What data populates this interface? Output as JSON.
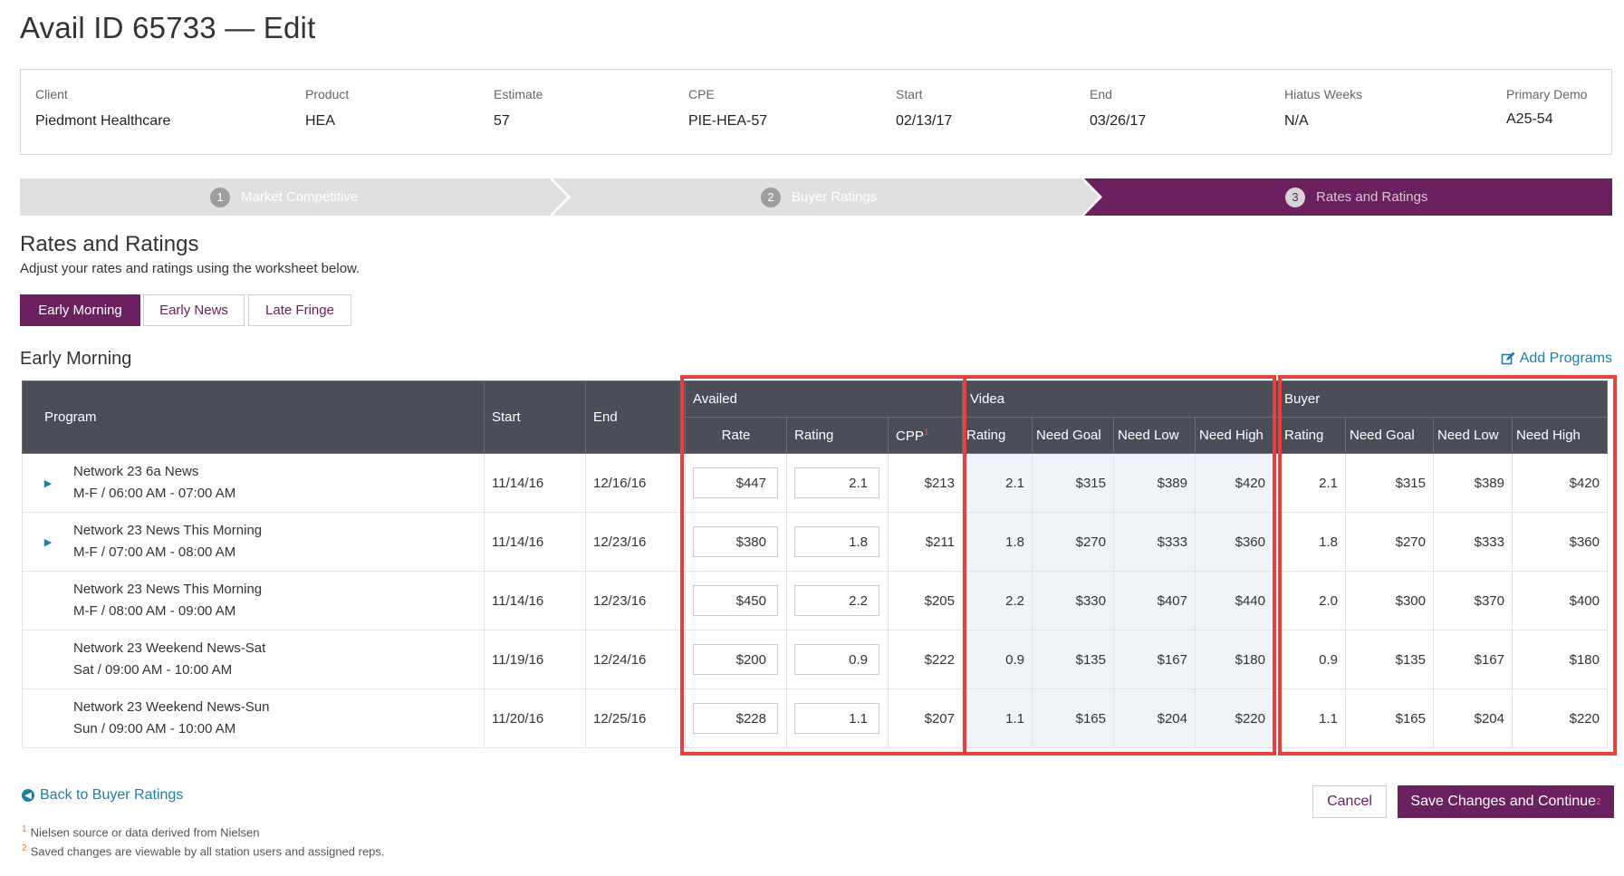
{
  "page_title": "Avail ID 65733 — Edit",
  "info": [
    {
      "label": "Client",
      "value": "Piedmont Healthcare"
    },
    {
      "label": "Product",
      "value": "HEA"
    },
    {
      "label": "Estimate",
      "value": "57"
    },
    {
      "label": "CPE",
      "value": "PIE-HEA-57"
    },
    {
      "label": "Start",
      "value": "02/13/17"
    },
    {
      "label": "End",
      "value": "03/26/17"
    },
    {
      "label": "Hiatus Weeks",
      "value": "N/A"
    },
    {
      "label": "Primary Demo",
      "value": "A25-54"
    }
  ],
  "steps": [
    {
      "num": "1",
      "label": "Market Competitive"
    },
    {
      "num": "2",
      "label": "Buyer Ratings"
    },
    {
      "num": "3",
      "label": "Rates and Ratings"
    }
  ],
  "section": {
    "title": "Rates and Ratings",
    "subtitle": "Adjust your rates and ratings using the worksheet below."
  },
  "tabs": [
    "Early Morning",
    "Early News",
    "Late Fringe"
  ],
  "group_title": "Early Morning",
  "add_programs": "Add Programs",
  "table": {
    "headers": {
      "program": "Program",
      "start": "Start",
      "end": "End",
      "availed": "Availed",
      "videa": "Videa",
      "buyer": "Buyer",
      "rate": "Rate",
      "rating": "Rating",
      "cpp": "CPP",
      "cpp_note": "1",
      "need_goal": "Need Goal",
      "need_low": "Need Low",
      "need_high": "Need High"
    },
    "rows": [
      {
        "name": "Network 23 6a News",
        "time": "M-F / 06:00 AM - 07:00 AM",
        "expandable": true,
        "start": "11/14/16",
        "end": "12/16/16",
        "rate": "$447",
        "rating": "2.1",
        "cpp": "$213",
        "videa": [
          "2.1",
          "$315",
          "$389",
          "$420"
        ],
        "buyer": [
          "2.1",
          "$315",
          "$389",
          "$420"
        ]
      },
      {
        "name": "Network 23 News This Morning",
        "time": "M-F / 07:00 AM - 08:00 AM",
        "expandable": true,
        "start": "11/14/16",
        "end": "12/23/16",
        "rate": "$380",
        "rating": "1.8",
        "cpp": "$211",
        "videa": [
          "1.8",
          "$270",
          "$333",
          "$360"
        ],
        "buyer": [
          "1.8",
          "$270",
          "$333",
          "$360"
        ]
      },
      {
        "name": "Network 23 News This Morning",
        "time": "M-F / 08:00 AM - 09:00 AM",
        "expandable": false,
        "start": "11/14/16",
        "end": "12/23/16",
        "rate": "$450",
        "rating": "2.2",
        "cpp": "$205",
        "videa": [
          "2.2",
          "$330",
          "$407",
          "$440"
        ],
        "buyer": [
          "2.0",
          "$300",
          "$370",
          "$400"
        ]
      },
      {
        "name": "Network 23 Weekend News-Sat",
        "time": "Sat / 09:00 AM - 10:00 AM",
        "expandable": false,
        "start": "11/19/16",
        "end": "12/24/16",
        "rate": "$200",
        "rating": "0.9",
        "cpp": "$222",
        "videa": [
          "0.9",
          "$135",
          "$167",
          "$180"
        ],
        "buyer": [
          "0.9",
          "$135",
          "$167",
          "$180"
        ]
      },
      {
        "name": "Network 23 Weekend News-Sun",
        "time": "Sun / 09:00 AM - 10:00 AM",
        "expandable": false,
        "start": "11/20/16",
        "end": "12/25/16",
        "rate": "$228",
        "rating": "1.1",
        "cpp": "$207",
        "videa": [
          "1.1",
          "$165",
          "$204",
          "$220"
        ],
        "buyer": [
          "1.1",
          "$165",
          "$204",
          "$220"
        ]
      }
    ]
  },
  "back_link": "Back to Buyer Ratings",
  "footnotes": [
    {
      "num": "1",
      "text": "Nielsen source or data derived from Nielsen"
    },
    {
      "num": "2",
      "text": "Saved changes are viewable by all station users and assigned reps."
    }
  ],
  "buttons": {
    "cancel": "Cancel",
    "save": "Save Changes and Continue",
    "save_note": "2"
  },
  "colors": {
    "brand": "#6b2060",
    "link": "#1d7fa3",
    "header": "#4b4e56",
    "highlight": "#e8403f"
  }
}
